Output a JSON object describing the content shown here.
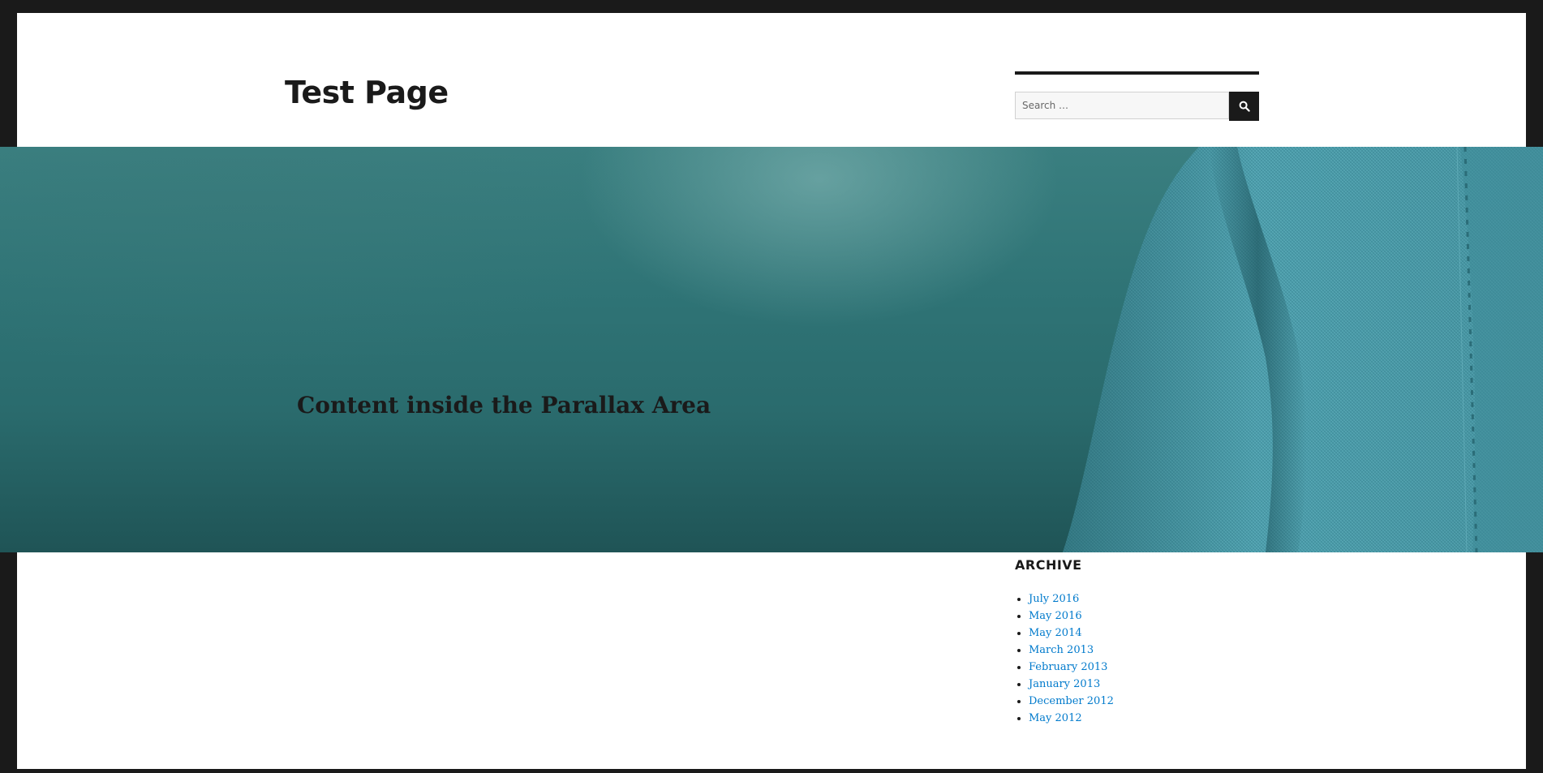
{
  "header": {
    "site_title": "Test Page"
  },
  "search": {
    "placeholder": "Search …",
    "button_icon": "search-icon"
  },
  "parallax": {
    "heading": "Content inside the Parallax Area"
  },
  "archive": {
    "title": "ARCHIVE",
    "items": [
      {
        "label": "July 2016"
      },
      {
        "label": "May 2016"
      },
      {
        "label": "May 2014"
      },
      {
        "label": "March 2013"
      },
      {
        "label": "February 2013"
      },
      {
        "label": "January 2013"
      },
      {
        "label": "December 2012"
      },
      {
        "label": "May 2012"
      }
    ]
  },
  "colors": {
    "link": "#007acc",
    "text": "#1a1a1a",
    "frame": "#1a1a1a",
    "parallax_teal": "#2f7476"
  }
}
